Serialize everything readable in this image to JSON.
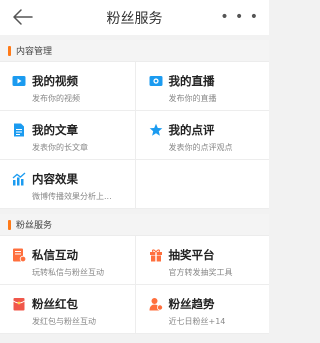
{
  "header": {
    "title": "粉丝服务",
    "more": "• • •"
  },
  "sections": [
    {
      "title": "内容管理",
      "items": [
        {
          "name": "我的视频",
          "desc": "发布你的视频",
          "icon": "video-icon"
        },
        {
          "name": "我的直播",
          "desc": "发布你的直播",
          "icon": "live-icon"
        },
        {
          "name": "我的文章",
          "desc": "发表你的长文章",
          "icon": "article-icon"
        },
        {
          "name": "我的点评",
          "desc": "发表你的点评观点",
          "icon": "review-star-icon"
        },
        {
          "name": "内容效果",
          "desc": "微博传播效果分析上...",
          "icon": "analytics-icon"
        }
      ]
    },
    {
      "title": "粉丝服务",
      "items": [
        {
          "name": "私信互动",
          "desc": "玩转私信与粉丝互动",
          "icon": "message-icon"
        },
        {
          "name": "抽奖平台",
          "desc": "官方转发抽奖工具",
          "icon": "gift-icon"
        },
        {
          "name": "粉丝红包",
          "desc": "发红包与粉丝互动",
          "icon": "red-envelope-icon"
        },
        {
          "name": "粉丝趋势",
          "desc": "近七日粉丝+14",
          "icon": "fans-trend-icon"
        }
      ]
    }
  ],
  "colors": {
    "accent": "#ff7a18",
    "blue": "#1b9bf0",
    "orange": "#ff6f3d",
    "red": "#f0574a"
  }
}
